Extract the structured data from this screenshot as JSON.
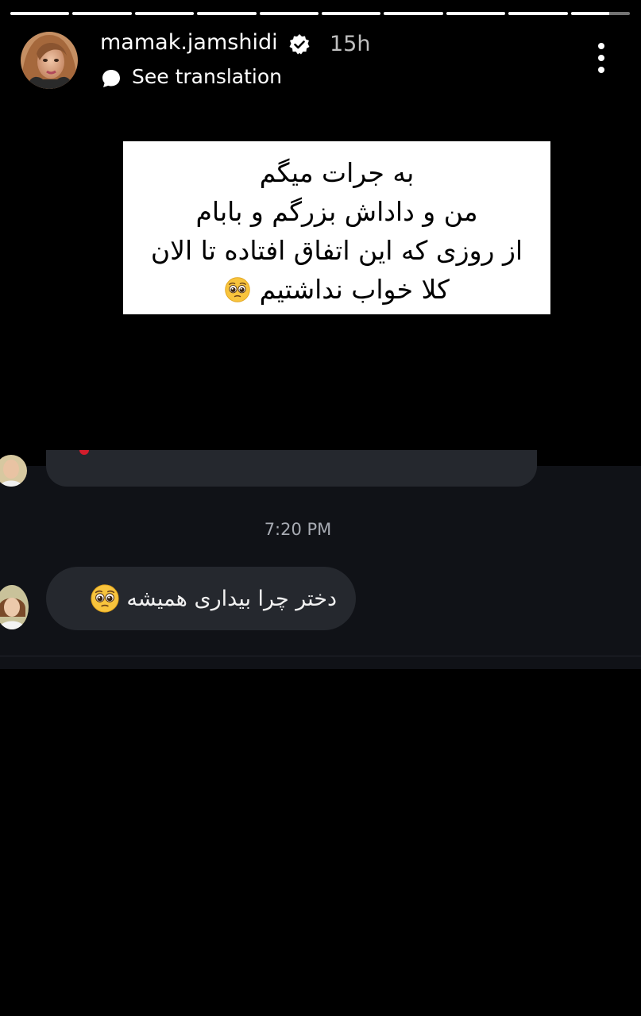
{
  "story": {
    "progress": {
      "segments": 10,
      "filled": [
        1,
        1,
        1,
        1,
        1,
        1,
        1,
        1,
        1,
        0.65
      ]
    },
    "header": {
      "username": "mamak.jamshidi",
      "time_ago": "15h",
      "translation_label": "See translation",
      "verified_icon": "verified-badge-icon",
      "more_icon": "more-vertical-icon"
    },
    "card": {
      "lines": [
        "به جرات میگم",
        "من و داداش بزرگم و بابام",
        "از روزی که این اتفاق افتاده تا الان",
        "کلا خواب نداشتیم"
      ],
      "trailing_emoji": "pleading-face-emoji"
    },
    "chat": {
      "timestamp": "7:20 PM",
      "message": "دختر چرا بیداری همیشه",
      "message_emoji": "pleading-face-emoji"
    },
    "colors": {
      "background": "#000000",
      "chat_background": "#101217",
      "bubble": "#25282e"
    }
  }
}
